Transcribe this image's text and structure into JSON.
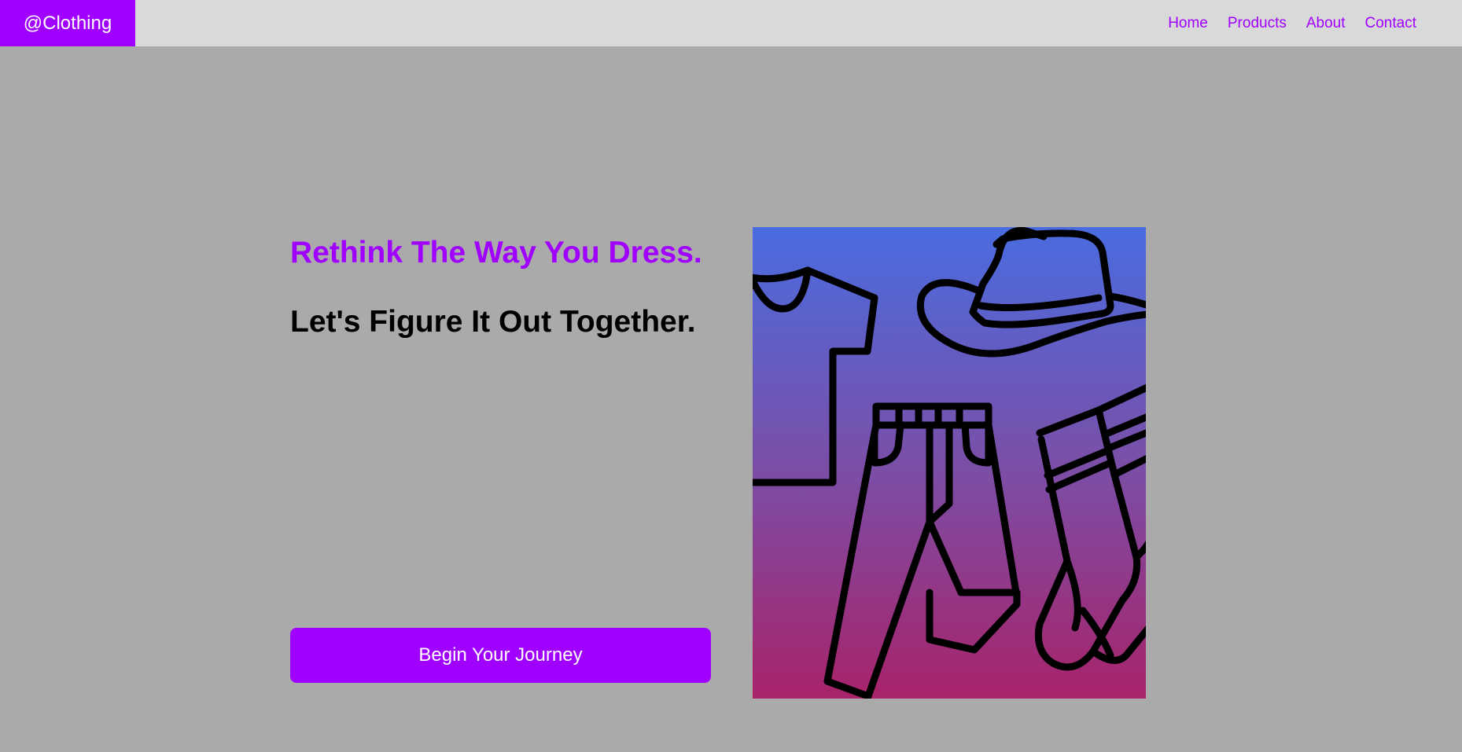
{
  "nav": {
    "brand": "@Clothing",
    "links": [
      "Home",
      "Products",
      "About",
      "Contact"
    ]
  },
  "hero": {
    "tagline": "Rethink The Way You Dress.",
    "subline": "Let's Figure It Out Together.",
    "cta_label": "Begin Your Journey",
    "image_icons": [
      "tshirt-icon",
      "hat-icon",
      "pants-icon",
      "socks-icon"
    ]
  },
  "colors": {
    "accent": "#a000ff",
    "navbar_bg": "#d9d9d9",
    "page_bg": "#aaaaaa",
    "gradient_top": "#4a6ce0",
    "gradient_bottom": "#a8236a"
  }
}
